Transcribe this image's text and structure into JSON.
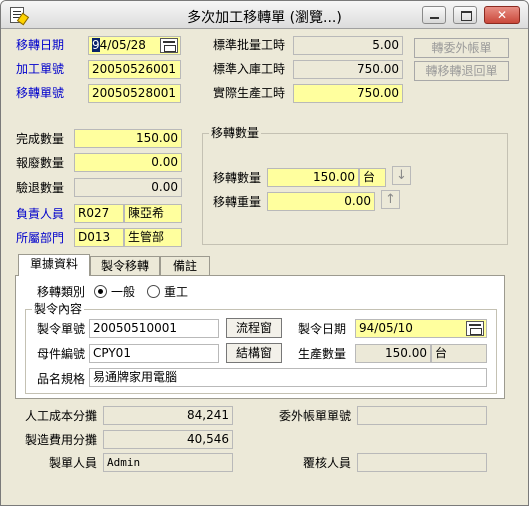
{
  "window": {
    "title": "多次加工移轉單 (瀏覽...)"
  },
  "header": {
    "transfer_date_label": "移轉日期",
    "transfer_date_sel": "9",
    "transfer_date_rest": "4/05/28",
    "process_no_label": "加工單號",
    "process_no": "20050526001",
    "transfer_no_label": "移轉單號",
    "transfer_no": "20050528001",
    "std_batch_label": "標準批量工時",
    "std_batch": "5.00",
    "std_inbound_label": "標準入庫工時",
    "std_inbound": "750.00",
    "actual_label": "實際生產工時",
    "actual": "750.00",
    "btn_outsource": "轉委外帳單",
    "btn_return": "轉移轉退回單"
  },
  "qty": {
    "done_label": "完成數量",
    "done": "150.00",
    "scrap_label": "報廢數量",
    "scrap": "0.00",
    "reject_label": "驗退數量",
    "reject": "0.00",
    "owner_label": "負責人員",
    "owner_code": "R027",
    "owner_name": "陳亞希",
    "dept_label": "所屬部門",
    "dept_code": "D013",
    "dept_name": "生管部"
  },
  "transfer_group": {
    "title": "移轉數量",
    "qty_label": "移轉數量",
    "qty": "150.00",
    "unit": "台",
    "weight_label": "移轉重量",
    "weight": "0.00",
    "down_arrow": "↓",
    "up_arrow": "↑"
  },
  "tabs": [
    "單據資料",
    "製令移轉",
    "備註"
  ],
  "doc": {
    "type_label": "移轉類別",
    "opt_normal": "一般",
    "opt_rework": "重工",
    "section_title": "製令內容",
    "order_no_label": "製令單號",
    "order_no": "20050510001",
    "btn_flow": "流程窗",
    "order_date_label": "製令日期",
    "order_date": "94/05/10",
    "parent_label": "母件編號",
    "parent_no": "CPY01",
    "btn_struct": "結構窗",
    "prod_qty_label": "生產數量",
    "prod_qty": "150.00",
    "prod_unit": "台",
    "spec_label": "品名規格",
    "spec": "易通牌家用電腦"
  },
  "footer": {
    "labor_label": "人工成本分攤",
    "labor": "84,241",
    "overhead_label": "製造費用分攤",
    "overhead": "40,546",
    "maker_label": "製單人員",
    "maker": "Admin",
    "outsource_no_label": "委外帳單單號",
    "outsource_no": "",
    "reviewer_label": "覆核人員",
    "reviewer": ""
  }
}
